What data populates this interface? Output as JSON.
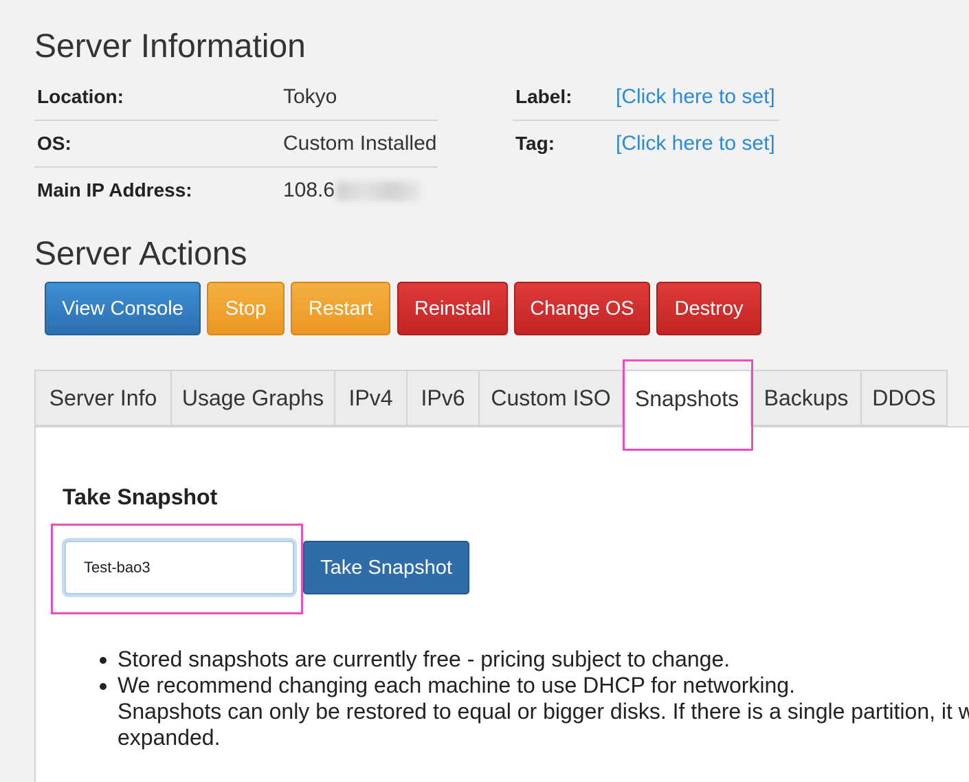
{
  "server_information": {
    "title": "Server Information",
    "left_rows": [
      {
        "key": "Location:",
        "value": "Tokyo"
      },
      {
        "key": "OS:",
        "value": "Custom Installed"
      },
      {
        "key": "Main IP Address:",
        "value": "108.6"
      }
    ],
    "right_rows": [
      {
        "key": "Label:",
        "value": "[Click here to set]"
      },
      {
        "key": "Tag:",
        "value": "[Click here to set]"
      }
    ]
  },
  "server_actions": {
    "title": "Server Actions",
    "buttons": [
      {
        "label": "View Console",
        "color": "#2c6fb0"
      },
      {
        "label": "Stop",
        "color": "#ec9722"
      },
      {
        "label": "Restart",
        "color": "#ec9722"
      },
      {
        "label": "Reinstall",
        "color": "#c52424"
      },
      {
        "label": "Change OS",
        "color": "#c52424"
      },
      {
        "label": "Destroy",
        "color": "#c52424"
      }
    ]
  },
  "tabs": [
    {
      "label": "Server Info"
    },
    {
      "label": "Usage Graphs"
    },
    {
      "label": "IPv4"
    },
    {
      "label": "IPv6"
    },
    {
      "label": "Custom ISO"
    },
    {
      "label": "Snapshots",
      "active": true
    },
    {
      "label": "Backups"
    },
    {
      "label": "DDOS"
    }
  ],
  "snapshot": {
    "title": "Take Snapshot",
    "input_value": "Test-bao3",
    "button_label": "Take Snapshot",
    "notes": [
      "Stored snapshots are currently free - pricing subject to change.",
      "We recommend changing each machine to use DHCP for networking.",
      "Snapshots can only be restored to equal or bigger disks. If there is a single partition, it w",
      "expanded."
    ]
  },
  "highlight_color": "#e84fc0"
}
